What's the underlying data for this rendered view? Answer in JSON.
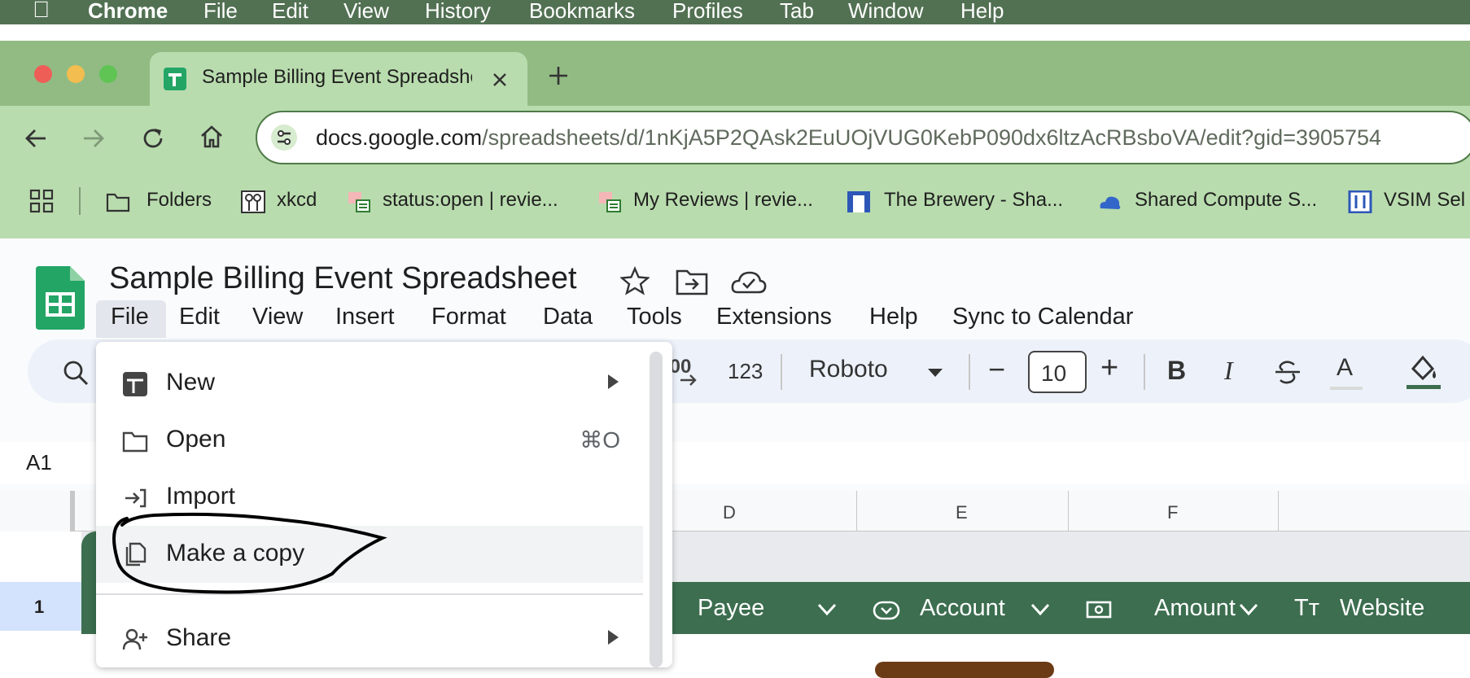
{
  "mac_menubar": {
    "app": "Chrome",
    "items": [
      "File",
      "Edit",
      "View",
      "History",
      "Bookmarks",
      "Profiles",
      "Tab",
      "Window",
      "Help"
    ]
  },
  "browser": {
    "tab_title": "Sample Billing Event Spreadsheet",
    "url_host": "docs.google.com",
    "url_path": "/spreadsheets/d/1nKjA5P2QAsk2EuUOjVUG0KebP090dx6ltzAcRBsboVA/edit?gid=3905754",
    "bookmarks": [
      "Folders",
      "xkcd",
      "status:open | revie...",
      "My Reviews | revie...",
      "The Brewery - Sha...",
      "Shared Compute S...",
      "VSIM Sel"
    ]
  },
  "sheets": {
    "doc_title": "Sample Billing Event Spreadsheet",
    "menus": [
      "File",
      "Edit",
      "View",
      "Insert",
      "Format",
      "Data",
      "Tools",
      "Extensions",
      "Help",
      "Sync to Calendar"
    ],
    "toolbar": {
      "decimal_label": ".00",
      "number_format": "123",
      "font": "Roboto",
      "font_size": "10",
      "minus": "−",
      "plus": "+",
      "bold": "B",
      "italic": "I",
      "text_color": "A"
    },
    "name_box": "A1",
    "columns": [
      "D",
      "E",
      "F"
    ],
    "row_number": "1",
    "header_band": [
      "Payee",
      "Account",
      "Amount",
      "Website"
    ],
    "header_band_prefix": "Tт"
  },
  "file_menu": {
    "items": [
      {
        "label": "New",
        "shortcut": "",
        "submenu": true
      },
      {
        "label": "Open",
        "shortcut": "⌘O",
        "submenu": false
      },
      {
        "label": "Import",
        "shortcut": "",
        "submenu": false
      },
      {
        "label": "Make a copy",
        "shortcut": "",
        "submenu": false
      },
      {
        "label": "Share",
        "shortcut": "",
        "submenu": true
      }
    ]
  },
  "colors": {
    "mac_bar": "#527153",
    "chrome_frame": "#92bb84",
    "chrome_toolbar": "#b9dcae",
    "sheets_green": "#3c6e4f",
    "annotation": "#000000"
  }
}
